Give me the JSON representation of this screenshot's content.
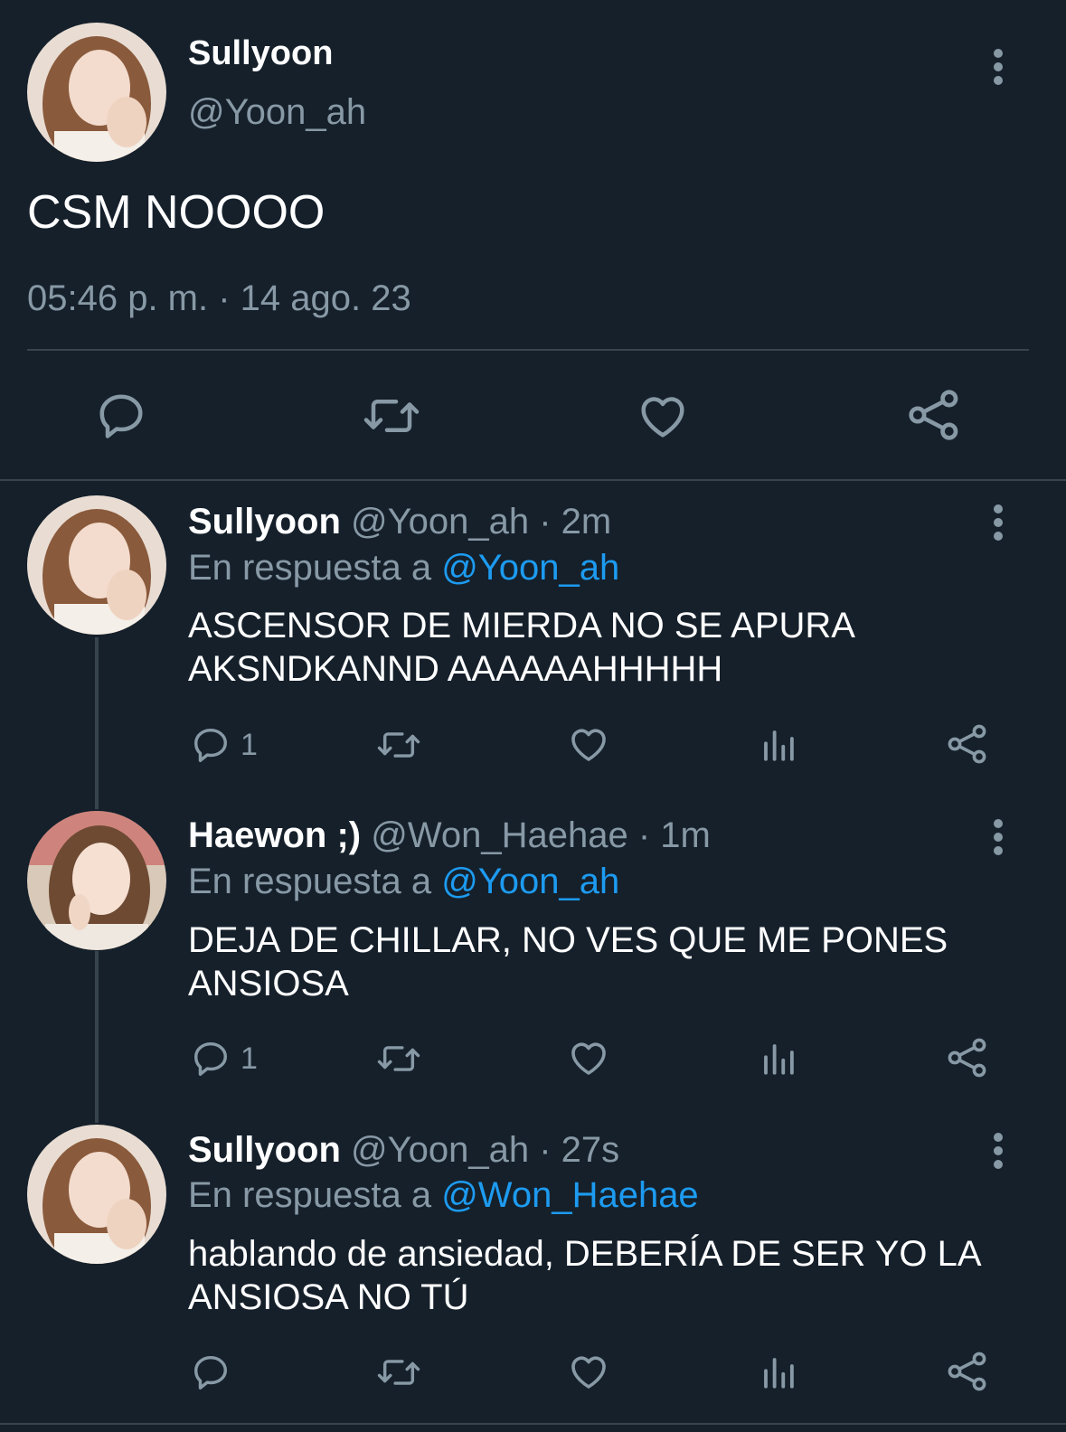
{
  "main_tweet": {
    "name": "Sullyoon",
    "handle": "@Yoon_ah",
    "text": "CSM NOOOO",
    "timestamp": "05:46 p. m. · 14 ago. 23",
    "actions": [
      "reply-icon",
      "retweet-icon",
      "like-icon",
      "share-icon"
    ]
  },
  "replies": [
    {
      "name": "Sullyoon",
      "handle_time": "@Yoon_ah · 2m",
      "reply_prefix": "En respuesta a",
      "reply_to": "@Yoon_ah",
      "line1": "ASCENSOR DE MIERDA NO SE APURA",
      "line2": "AKSNDKANND AAAAAAHHHHH",
      "reply_count": "1"
    },
    {
      "name": "Haewon ;)",
      "handle_time": "@Won_Haehae · 1m",
      "reply_prefix": "En respuesta a",
      "reply_to": "@Yoon_ah",
      "line1": "DEJA DE CHILLAR, NO VES QUE ME PONES",
      "line2": "ANSIOSA",
      "reply_count": "1"
    },
    {
      "name": "Sullyoon",
      "handle_time": "@Yoon_ah · 27s",
      "reply_prefix": "En respuesta a",
      "reply_to": "@Won_Haehae",
      "line1": "hablando de ansiedad, DEBERÍA DE SER YO LA",
      "line2": "ANSIOSA NO TÚ",
      "reply_count": ""
    }
  ],
  "colors": {
    "background": "#15202b",
    "text": "#ffffff",
    "secondary": "#8899a6",
    "accent": "#1d9bf0",
    "divider": "#38444d"
  }
}
